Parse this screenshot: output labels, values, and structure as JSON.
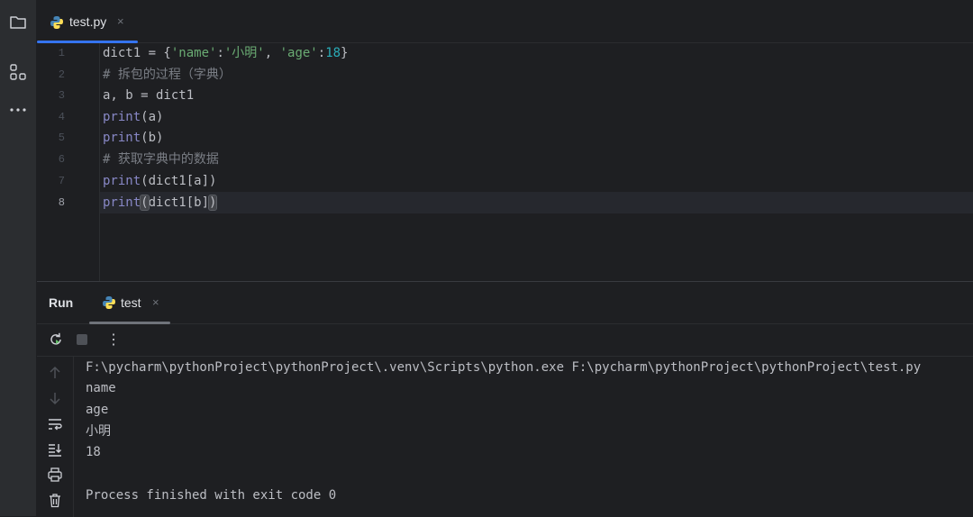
{
  "editor": {
    "tab": {
      "label": "test.py",
      "close": "×"
    },
    "line_numbers": [
      "1",
      "2",
      "3",
      "4",
      "5",
      "6",
      "7",
      "8"
    ],
    "active_line": "8"
  },
  "code": {
    "l1": {
      "a": "dict1 = {",
      "s1": "'name'",
      "b": ":",
      "s2": "'小明'",
      "c": ", ",
      "s3": "'age'",
      "d": ":",
      "n": "18",
      "e": "}"
    },
    "l2": "# 拆包的过程（字典）",
    "l3": "a, b = dict1",
    "l4": {
      "fn": "print",
      "rest": "(a)"
    },
    "l5": {
      "fn": "print",
      "rest": "(b)"
    },
    "l6": "# 获取字典中的数据",
    "l7": {
      "fn": "print",
      "rest": "(dict1[a])"
    },
    "l8": {
      "fn": "print",
      "open": "(",
      "mid": "dict1[b]",
      "close": ")"
    }
  },
  "run": {
    "title": "Run",
    "tab": {
      "label": "test",
      "close": "×"
    },
    "more_label": "⋮",
    "output": [
      "F:\\pycharm\\pythonProject\\pythonProject\\.venv\\Scripts\\python.exe F:\\pycharm\\pythonProject\\pythonProject\\test.py",
      "name",
      "age",
      "小明",
      "18",
      "",
      "Process finished with exit code 0"
    ]
  },
  "icons": {
    "project": "folder-icon",
    "structure": "structure-icon",
    "more": "more-horizontal-icon",
    "python": "python-icon",
    "rerun": "rerun-icon",
    "stop": "stop-icon",
    "up": "arrow-up-icon",
    "down": "arrow-down-icon",
    "soft_wrap": "soft-wrap-icon",
    "scroll_end": "scroll-to-end-icon",
    "print": "print-icon",
    "trash": "trash-icon"
  },
  "colors": {
    "accent": "#3574f0",
    "string": "#6aab73",
    "number": "#2aacb8",
    "builtin": "#8888c6",
    "comment": "#7a7e85"
  }
}
